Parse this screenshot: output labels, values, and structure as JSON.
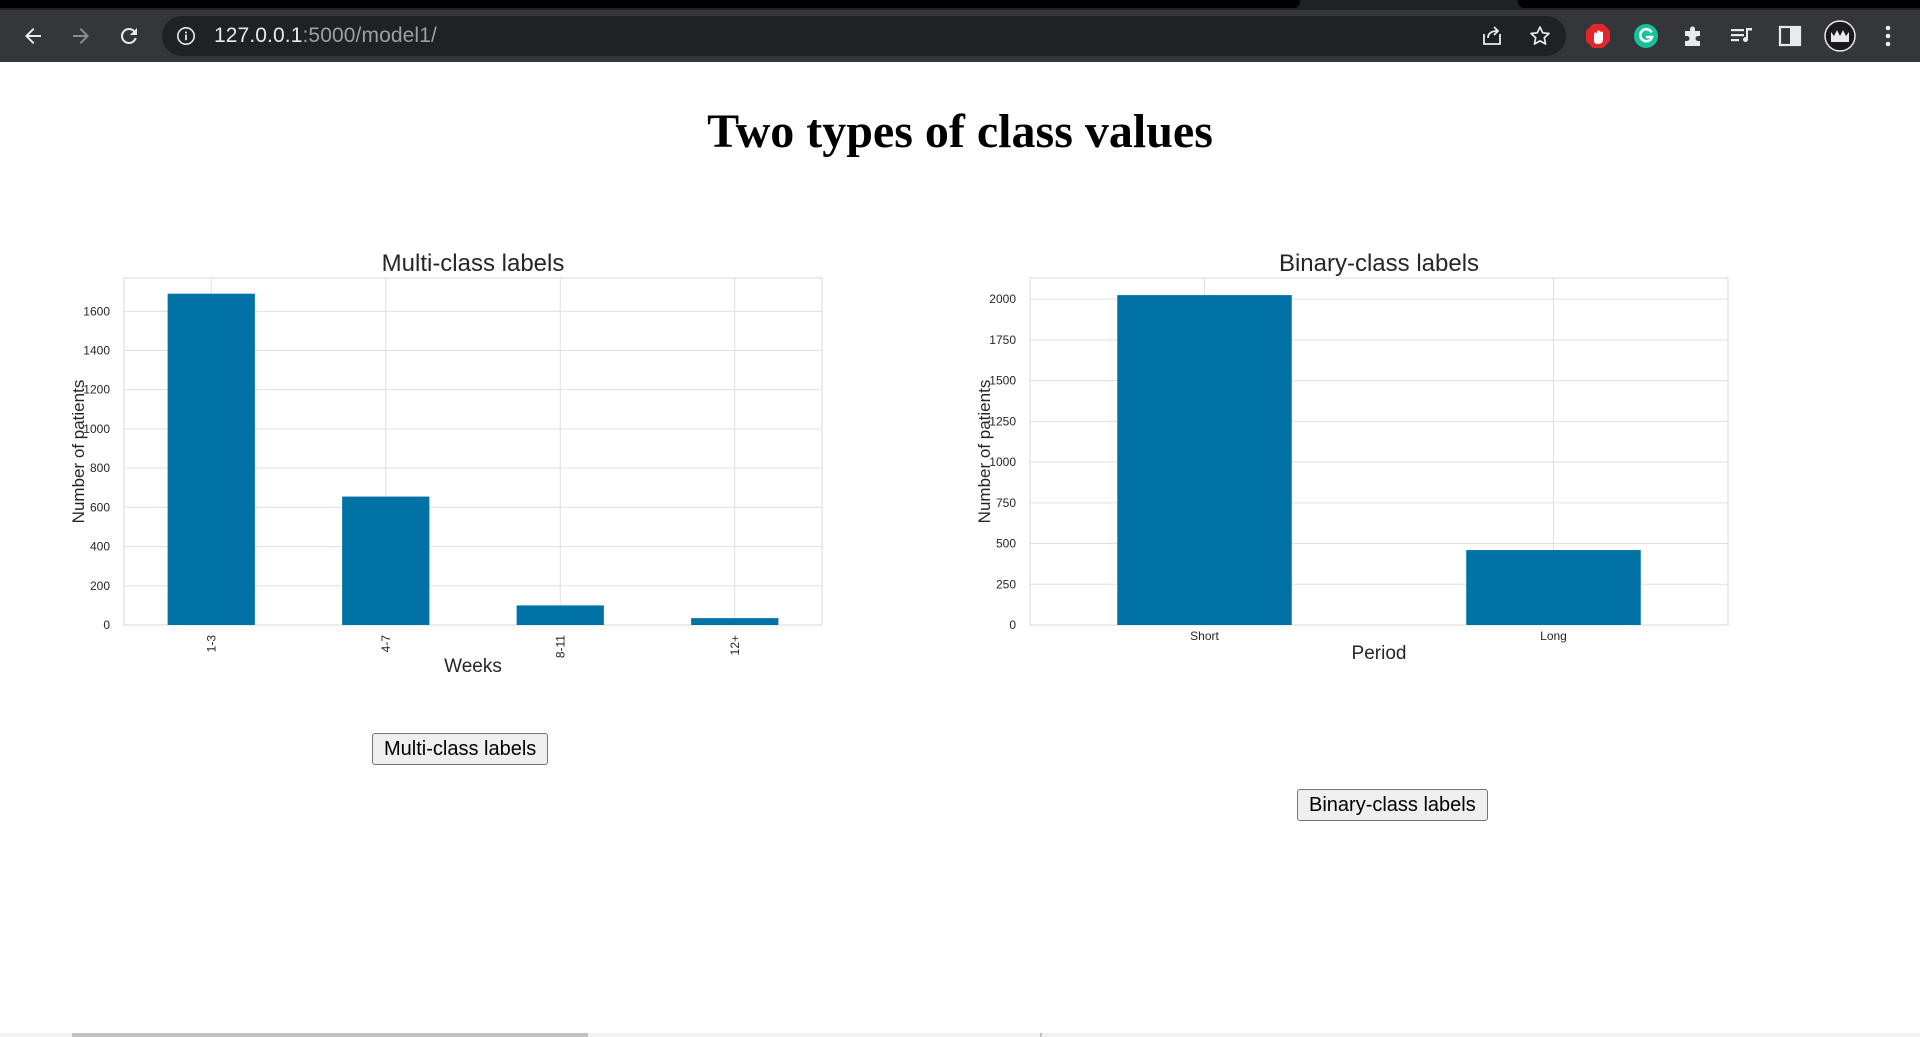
{
  "browser": {
    "url_host": "127.0.0.1",
    "url_path": ":5000/model1/"
  },
  "page": {
    "title": "Two types of class values"
  },
  "buttons": {
    "multi_label": "Multi-class labels",
    "binary_label": "Binary-class labels"
  },
  "colors": {
    "bar": "#0072a6",
    "grid": "#e0e0e0",
    "chrome_bg": "#35363a",
    "omnibox_bg": "#202124"
  },
  "icons": [
    "back-arrow-icon",
    "forward-arrow-icon",
    "reload-icon",
    "info-icon",
    "share-icon",
    "star-icon",
    "adblock-extension-icon",
    "grammarly-extension-icon",
    "puzzle-extensions-icon",
    "reading-list-icon",
    "side-panel-icon",
    "profile-avatar-icon",
    "kebab-menu-icon"
  ],
  "chart_data": [
    {
      "type": "bar",
      "title": "Multi-class labels",
      "xlabel": "Weeks",
      "ylabel": "Number of patients",
      "categories": [
        "1-3",
        "4-7",
        "8-11",
        "12+"
      ],
      "values": [
        1690,
        655,
        100,
        35
      ],
      "ylim": [
        0,
        1770
      ],
      "yticks": [
        0,
        200,
        400,
        600,
        800,
        1000,
        1200,
        1400,
        1600
      ],
      "xtick_rotation": "vertical",
      "grid": true
    },
    {
      "type": "bar",
      "title": "Binary-class labels",
      "xlabel": "Period",
      "ylabel": "Number of patients",
      "categories": [
        "Short",
        "Long"
      ],
      "values": [
        2025,
        460
      ],
      "ylim": [
        0,
        2130
      ],
      "yticks": [
        0,
        250,
        500,
        750,
        1000,
        1250,
        1500,
        1750,
        2000
      ],
      "xtick_rotation": "horizontal",
      "grid": true
    }
  ]
}
